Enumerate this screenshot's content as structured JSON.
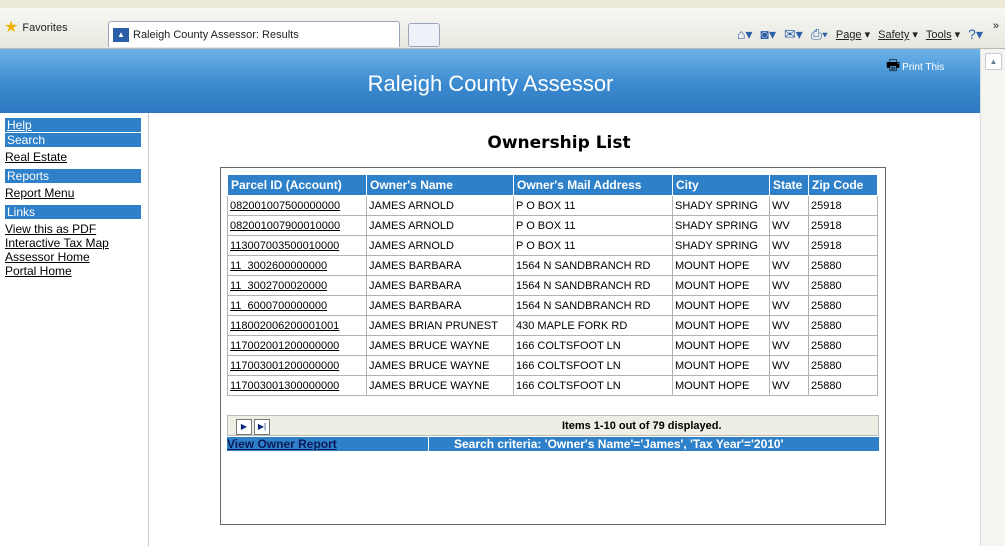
{
  "browser": {
    "favorites_label": "Favorites",
    "tab_title": "Raleigh County Assessor: Results",
    "tools": {
      "page": "Page",
      "safety": "Safety",
      "tools": "Tools"
    }
  },
  "header": {
    "title": "Raleigh County Assessor",
    "print_label": "Print This"
  },
  "sidebar": {
    "help": "Help",
    "search": "Search",
    "real_estate": "Real Estate",
    "reports": "Reports",
    "report_menu": "Report Menu",
    "links": "Links",
    "view_pdf": "View this as PDF",
    "tax_map": "Interactive Tax Map",
    "assessor_home": "Assessor Home",
    "portal_home": "Portal Home"
  },
  "main": {
    "heading": "Ownership List",
    "columns": [
      "Parcel ID (Account)",
      "Owner's Name",
      "Owner's Mail Address",
      "City",
      "State",
      "Zip Code"
    ],
    "rows": [
      [
        "082001007500000000",
        "JAMES ARNOLD",
        "P O BOX 11",
        "SHADY SPRING",
        "WV",
        "25918"
      ],
      [
        "082001007900010000",
        "JAMES ARNOLD",
        "P O BOX 11",
        "SHADY SPRING",
        "WV",
        "25918"
      ],
      [
        "113007003500010000",
        "JAMES ARNOLD",
        "P O BOX 11",
        "SHADY SPRING",
        "WV",
        "25918"
      ],
      [
        "11  3002600000000",
        "JAMES BARBARA",
        "1564 N SANDBRANCH RD",
        "MOUNT HOPE",
        "WV",
        "25880"
      ],
      [
        "11  3002700020000",
        "JAMES BARBARA",
        "1564 N SANDBRANCH RD",
        "MOUNT HOPE",
        "WV",
        "25880"
      ],
      [
        "11  6000700000000",
        "JAMES BARBARA",
        "1564 N SANDBRANCH RD",
        "MOUNT HOPE",
        "WV",
        "25880"
      ],
      [
        "118002006200001001",
        "JAMES BRIAN PRUNEST",
        "430 MAPLE FORK RD",
        "MOUNT HOPE",
        "WV",
        "25880"
      ],
      [
        "117002001200000000",
        "JAMES BRUCE WAYNE",
        "166 COLTSFOOT LN",
        "MOUNT HOPE",
        "WV",
        "25880"
      ],
      [
        "117003001200000000",
        "JAMES BRUCE WAYNE",
        "166 COLTSFOOT LN",
        "MOUNT HOPE",
        "WV",
        "25880"
      ],
      [
        "117003001300000000",
        "JAMES BRUCE WAYNE",
        "166 COLTSFOOT LN",
        "MOUNT HOPE",
        "WV",
        "25880"
      ]
    ],
    "pager_text": "Items 1-10 out of 79 displayed.",
    "view_owner_report": "View Owner Report",
    "search_criteria": "Search criteria: 'Owner's Name'='James', 'Tax Year'='2010'"
  }
}
